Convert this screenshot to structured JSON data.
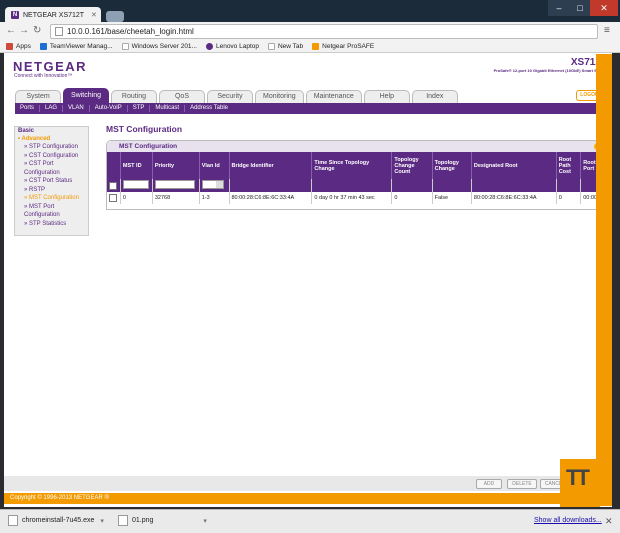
{
  "browser": {
    "tab_title": "NETGEAR XS712T",
    "url": "10.0.0.161/base/cheetah_login.html",
    "bookmarks": [
      "Apps",
      "TeamViewer Manag...",
      "Windows Server 201...",
      "Lenovo Laptop",
      "New Tab",
      "Netgear ProSAFE"
    ]
  },
  "header": {
    "brand": "NETGEAR",
    "tagline": "Connect with Innovation™",
    "model": "XS712T",
    "model_desc": "ProSafe® 12-port 10 Gigabit Ethernet (10GbE) Smart Switch",
    "logout": "LOGOUT"
  },
  "main_tabs": [
    "System",
    "Switching",
    "Routing",
    "QoS",
    "Security",
    "Monitoring",
    "Maintenance",
    "Help",
    "Index"
  ],
  "active_tab": "Switching",
  "sub_nav": [
    "Ports",
    "LAG",
    "VLAN",
    "Auto-VoIP",
    "STP",
    "Multicast",
    "Address Table"
  ],
  "side_menu": {
    "basic": "Basic",
    "advanced": "• Advanced",
    "items": [
      "» STP Configuration",
      "» CST Configuration",
      "» CST Port",
      "Configuration",
      "» CST Port Status",
      "» RSTP",
      "» MST Configuration",
      "» MST Port",
      "Configuration",
      "» STP Statistics"
    ]
  },
  "page_title": "MST Configuration",
  "panel_title": "MST Configuration",
  "table": {
    "headers": [
      "",
      "MST ID",
      "Priority",
      "Vlan Id",
      "Bridge Identifier",
      "Time Since Topology Change",
      "Topology Change Count",
      "Topology Change",
      "Designated Root",
      "Root Path Cost",
      "Root Port"
    ],
    "row": [
      "",
      "0",
      "32768",
      "1-3",
      "80:00:28:C6:8E:6C:33:4A",
      "0 day 0 hr 37 min 43 sec",
      "0",
      "False",
      "80:00:28:C6:8E:6C:33:4A",
      "0",
      "00:00"
    ]
  },
  "buttons": {
    "add": "ADD",
    "delete": "DELETE",
    "cancel": "CANCEL"
  },
  "footer": "Copyright © 1996-2013 NETGEAR ®",
  "downloads": {
    "item1": "chromeinstall-7u45.exe",
    "item2": "01.png",
    "show_all": "Show all downloads..."
  }
}
